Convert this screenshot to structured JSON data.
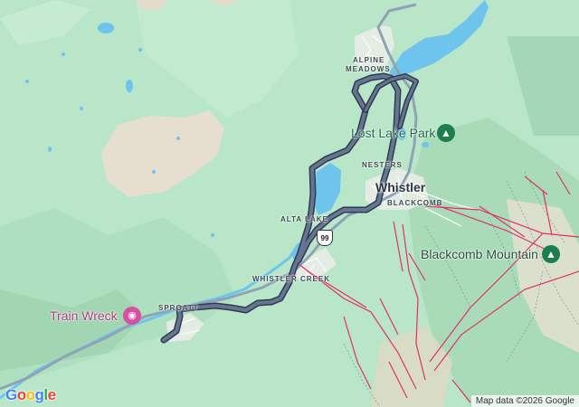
{
  "map": {
    "labels": {
      "alpine_meadows_line1": "ALPINE",
      "alpine_meadows_line2": "MEADOWS",
      "lost_lake_park": "Lost Lake Park",
      "nesters": "NESTERS",
      "whistler": "Whistler",
      "blackcomb": "BLACKCOMB",
      "alta_lake": "ALTA LAKE",
      "blackcomb_mountain": "Blackcomb Mountain",
      "whistler_creek": "WHISTLER CREEK",
      "sproatt": "SPROATT",
      "train_wreck": "Train Wreck"
    },
    "highway_shield": "99",
    "icons": {
      "park": "tree-icon",
      "attraction": "camera-icon",
      "mountain": "mountain-icon"
    },
    "logo": [
      "G",
      "o",
      "o",
      "g",
      "l",
      "e"
    ],
    "logo_colors": [
      "#4285F4",
      "#EA4335",
      "#FBBC05",
      "#4285F4",
      "#34A853",
      "#EA4335"
    ],
    "attribution": "Map data ©2026 Google",
    "colors": {
      "land": "#b7e4c7",
      "water": "#6ec4ec",
      "route": "#5c6b8a",
      "route_outline": "#2f3a55",
      "ski_runs": "#e0306a",
      "park_pin": "#1e7e4e",
      "attraction_pin": "#d94fa0"
    }
  }
}
